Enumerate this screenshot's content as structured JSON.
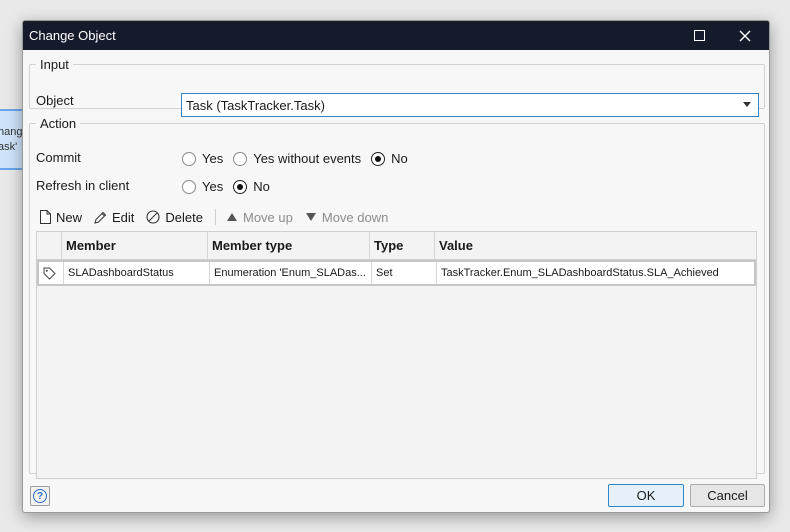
{
  "background": {
    "node_line1": "hang",
    "node_line2": "ask'"
  },
  "window": {
    "title": "Change Object",
    "maximize_icon": "maximize-icon",
    "close_icon": "close-icon"
  },
  "input_group": {
    "legend": "Input",
    "object_label": "Object",
    "object_value": "Task (TaskTracker.Task)"
  },
  "action_group": {
    "legend": "Action",
    "commit": {
      "label": "Commit",
      "options": [
        "Yes",
        "Yes without events",
        "No"
      ],
      "selected": "No"
    },
    "refresh": {
      "label": "Refresh in client",
      "options": [
        "Yes",
        "No"
      ],
      "selected": "No"
    },
    "toolbar": {
      "new": "New",
      "edit": "Edit",
      "delete": "Delete",
      "move_up": "Move up",
      "move_down": "Move down"
    },
    "table": {
      "columns": [
        "",
        "Member",
        "Member type",
        "Type",
        "Value"
      ],
      "rows": [
        {
          "icon": "tag-icon",
          "member": "SLADashboardStatus",
          "member_type": "Enumeration 'Enum_SLADas...",
          "type": "Set",
          "value": "TaskTracker.Enum_SLADashboardStatus.SLA_Achieved"
        }
      ]
    }
  },
  "footer": {
    "help_icon": "help-icon",
    "ok": "OK",
    "cancel": "Cancel"
  },
  "colors": {
    "titlebar": "#151b2b",
    "accent": "#2e86c9"
  }
}
